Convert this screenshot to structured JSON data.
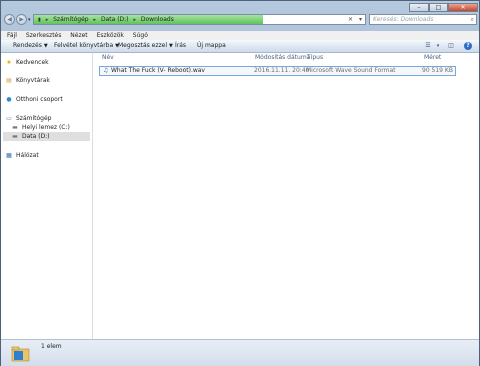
{
  "window_controls": {
    "minimize": "–",
    "maximize": "□",
    "close": "✕"
  },
  "address": {
    "crumbs": [
      "Számítógép",
      "Data (D:)",
      "Downloads"
    ],
    "refresh_icon": "✕",
    "dropdown_icon": "▾"
  },
  "search": {
    "placeholder": "Keresés: Downloads",
    "icon": "⌕"
  },
  "menu": [
    "Fájl",
    "Szerkesztés",
    "Nézet",
    "Eszközök",
    "Súgó"
  ],
  "toolbar": {
    "organize": "Rendezés",
    "add_library": "Felvétel könyvtárba",
    "share": "Megosztás ezzel",
    "burn": "Írás",
    "new_folder": "Új mappa"
  },
  "nav": {
    "favorites": "Kedvencek",
    "libraries": "Könyvtárak",
    "homegroup": "Otthoni csoport",
    "computer": "Számítógép",
    "local_disk": "Helyi lemez (C:)",
    "data_disk": "Data (D:)",
    "network": "Hálózat"
  },
  "columns": {
    "name": "Név",
    "modified": "Módosítás dátuma",
    "type": "Típus",
    "size": "Méret"
  },
  "files": [
    {
      "name": "What The Fuck (V- Reboot).wav",
      "modified": "2016.11.11. 20:40",
      "type": "Microsoft Wave Sound Format",
      "size": "90 519 KB"
    }
  ],
  "status": {
    "count": "1 elem"
  }
}
